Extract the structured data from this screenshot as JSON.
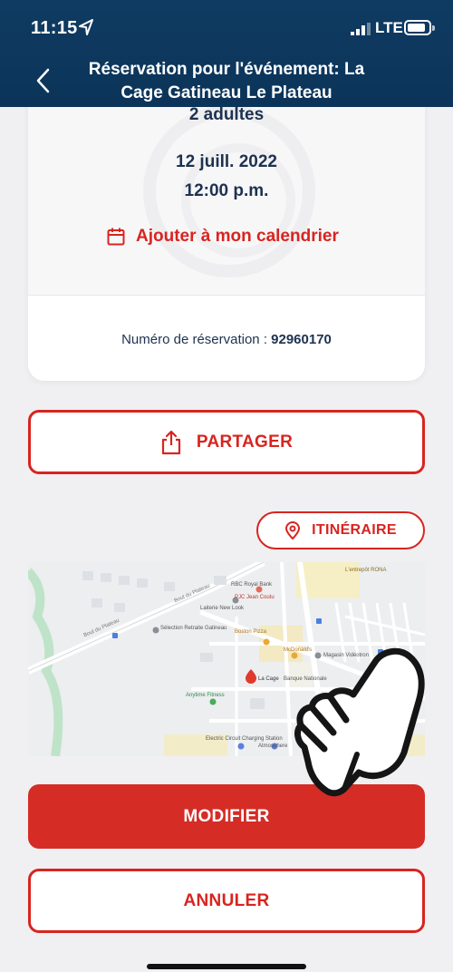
{
  "status_bar": {
    "time": "11:15",
    "network": "LTE"
  },
  "header": {
    "title": "Réservation pour l'événement: La Cage Gatineau Le Plateau"
  },
  "reservation": {
    "guests": "2 adultes",
    "date": "12 juill. 2022",
    "time": "12:00 p.m.",
    "calendar_link": "Ajouter à mon calendrier",
    "number_label": "Numéro de réservation : ",
    "number": "92960170"
  },
  "actions": {
    "share": "PARTAGER",
    "directions": "ITINÉRAIRE",
    "modify": "MODIFIER",
    "cancel": "ANNULER"
  },
  "map": {
    "labels": {
      "rbc": "RBC Royal Bank",
      "pjc": "PJC Jean Coutu",
      "rona": "L'entrepôt RONA",
      "laiterie": "Laiterie New Look",
      "selection": "Sélection Retraite Gatineau",
      "boston": "Boston Pizza",
      "mcdo": "McDonald's",
      "videotron": "Magasin Vidéotron",
      "lacage": "La Cage",
      "banque": "Banque Nationale",
      "anytime": "Anytime Fitness",
      "electric": "Electric Circuit Charging Station",
      "atmosphere": "Atmosphere",
      "blvd1": "Boul du Plateau",
      "blvd2": "Boul du Plateau"
    }
  },
  "colors": {
    "brand_red": "#d8241f",
    "navy": "#0f3b62",
    "text_dark": "#1d3250"
  }
}
